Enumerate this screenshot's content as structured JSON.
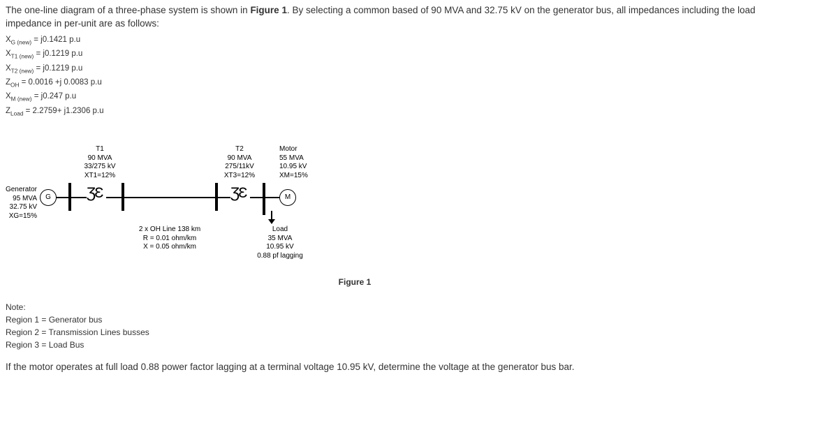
{
  "intro": {
    "line1_a": "The one-line diagram of a three-phase system is shown in ",
    "line1_bold": "Figure 1",
    "line1_b": ". By selecting a common based of 90 MVA and 32.75 kV on the generator bus, all impedances including the load",
    "line2": "impedance in per-unit are as follows:"
  },
  "pu": {
    "xg_pre": "X",
    "xg_sub": "G (new)",
    "xg_val": " = j0.1421 p.u",
    "xt1_pre": "X",
    "xt1_sub": "T1 (new)",
    "xt1_val": " = j0.1219 p.u",
    "xt2_pre": "X",
    "xt2_sub": "T2 (new)",
    "xt2_val": " = j0.1219 p.u",
    "zoh_pre": "Z",
    "zoh_sub": "OH",
    "zoh_val": " = 0.0016 +j 0.0083 p.u",
    "xm_pre": "X",
    "xm_sub": "M (new)",
    "xm_val": " = j0.247 p.u",
    "zl_pre": "Z",
    "zl_sub": "Load",
    "zl_val": " = 2.2759+ j1.2306 p.u"
  },
  "fig": {
    "gen": {
      "title": "Generator",
      "l2": "95 MVA",
      "l3": "32.75 kV",
      "l4": "XG=15%",
      "letter": "G"
    },
    "t1": {
      "title": "T1",
      "l2": "90 MVA",
      "l3": "33/275 kV",
      "l4": "XT1=12%"
    },
    "ohl": {
      "l1": "2 x OH Line 138 km",
      "l2": "R = 0.01 ohm/km",
      "l3": "X = 0.05 ohm/km"
    },
    "t2": {
      "title": "T2",
      "l2": "90 MVA",
      "l3": "275/11kV",
      "l4": "XT3=12%"
    },
    "motor": {
      "title": "Motor",
      "l2": "55 MVA",
      "l3": "10.95 kV",
      "l4": "XM=15%",
      "letter": "M"
    },
    "load": {
      "l1": "Load",
      "l2": "35 MVA",
      "l3": "10.95 kV",
      "l4": "0.88 pf lagging"
    },
    "caption": "Figure 1"
  },
  "note": {
    "title": "Note:",
    "r1": "Region 1 =  Generator bus",
    "r2": "Region 2 =  Transmission Lines busses",
    "r3": "Region 3 =  Load Bus"
  },
  "question": "If the motor operates at full load 0.88 power factor lagging at a terminal voltage 10.95 kV, determine the voltage at the generator bus bar."
}
